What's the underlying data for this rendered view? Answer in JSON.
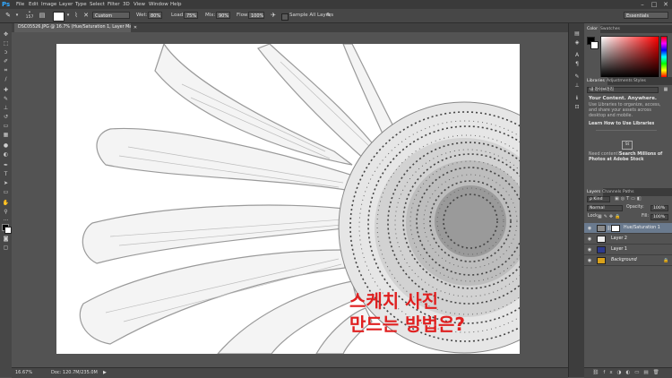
{
  "app": {
    "logo": "Ps"
  },
  "menu": [
    "File",
    "Edit",
    "Image",
    "Layer",
    "Type",
    "Select",
    "Filter",
    "3D",
    "View",
    "Window",
    "Help"
  ],
  "window_controls": [
    "–",
    "□",
    "✕"
  ],
  "options": {
    "brush_size": "157",
    "mode_value": "Custom",
    "wet_label": "Wet:",
    "wet_value": "80%",
    "load_label": "Load:",
    "load_value": "75%",
    "mix_label": "Mix:",
    "mix_value": "90%",
    "flow_label": "Flow:",
    "flow_value": "100%",
    "sample_all_label": "Sample All Layers",
    "workspace_value": "Essentials"
  },
  "document": {
    "tab_title": "DSC05526.JPG @ 16.7% (Hue/Saturation 1, Layer Mask/8) *",
    "overlay_line1": "스케치 사진",
    "overlay_line2": "만드는 방법은?"
  },
  "status": {
    "zoom": "16.67%",
    "doc": "Doc: 120.7M/235.0M"
  },
  "color_panel": {
    "tabs": [
      "Color",
      "Swatches"
    ]
  },
  "libraries_panel": {
    "tabs": [
      "Libraries",
      "Adjustments",
      "Styles"
    ],
    "dropdown": "내 라이브러리",
    "heading": "Your Content. Anywhere.",
    "body": "Use Libraries to organize, access, and share your assets across desktop and mobile.",
    "link": "Learn How to Use Libraries",
    "badge": "St",
    "need_content": "Need content?",
    "search_link": "Search Millions of Photos at Adobe Stock"
  },
  "layers_panel": {
    "tabs": [
      "Layers",
      "Channels",
      "Paths"
    ],
    "kind_label": "ρ Kind",
    "blend_mode": "Normal",
    "opacity_label": "Opacity:",
    "opacity_value": "100%",
    "lock_label": "Lock:",
    "fill_label": "Fill:",
    "fill_value": "100%",
    "layers": [
      {
        "name": "Hue/Saturation 1"
      },
      {
        "name": "Layer 2"
      },
      {
        "name": "Layer 1"
      },
      {
        "name": "Background"
      }
    ]
  },
  "icons": {
    "tools": [
      "move-icon",
      "marquee-icon",
      "lasso-icon",
      "quick-select-icon",
      "crop-icon",
      "eyedropper-icon",
      "healing-icon",
      "brush-icon",
      "clone-stamp-icon",
      "history-brush-icon",
      "eraser-icon",
      "gradient-icon",
      "blur-icon",
      "dodge-icon",
      "pen-icon",
      "type-icon",
      "path-select-icon",
      "rectangle-icon",
      "hand-icon",
      "zoom-icon"
    ]
  }
}
